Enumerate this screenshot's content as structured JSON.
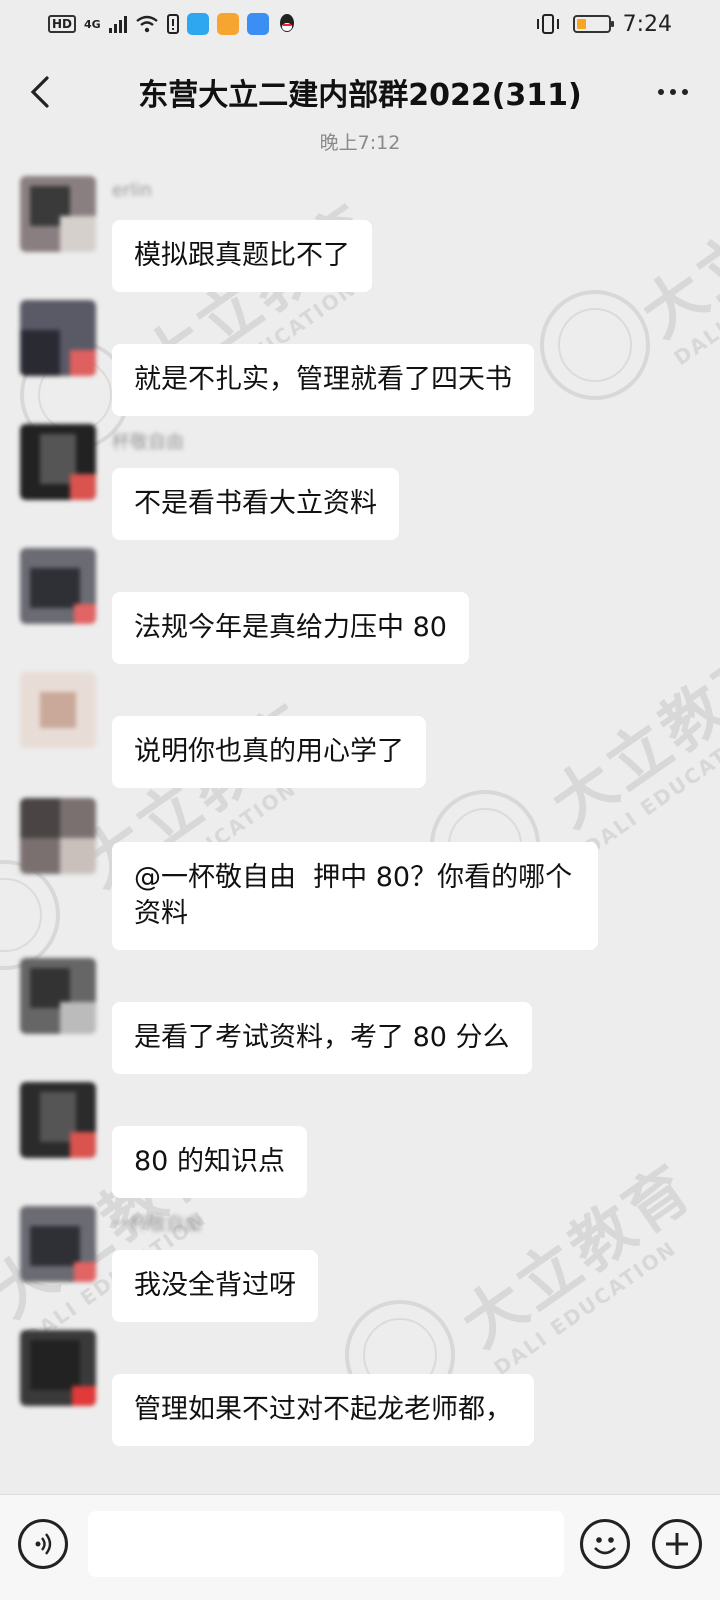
{
  "status_bar": {
    "hd_label": "HD",
    "network_label": "4G",
    "time": "7:24",
    "battery_color": "#f5a623",
    "icons": [
      "wifi-icon",
      "alert-icon",
      "app-blue-icon",
      "app-orange-icon",
      "app-search-icon",
      "qq-icon",
      "vibrate-icon"
    ]
  },
  "nav": {
    "title": "东营大立二建内部群2022(311)",
    "back_icon": "chevron-left-icon",
    "more_icon": "more-dots-icon"
  },
  "timestamp": "晚上7:12",
  "messages": [
    {
      "sender": "erlin",
      "text": "模拟跟真题比不了"
    },
    {
      "sender": "",
      "text": "就是不扎实，管理就看了四天书"
    },
    {
      "sender": "杯敬自由",
      "text": "不是看书看大立资料"
    },
    {
      "sender": "",
      "text": "法规今年是真给力压中 80"
    },
    {
      "sender": "",
      "text": "说明你也真的用心学了"
    },
    {
      "sender": "",
      "text": "@一杯敬自由  押中 80？你看的哪个资料"
    },
    {
      "sender": "",
      "text": "是看了考试资料，考了 80 分么"
    },
    {
      "sender": "",
      "text": "80 的知识点"
    },
    {
      "sender": "一杯敬自由",
      "text": "我没全背过呀"
    },
    {
      "sender": "",
      "text": "管理如果不过对不起龙老师都，"
    }
  ],
  "watermark": {
    "cn": "大立教育",
    "en": "DALI EDUCATION"
  },
  "input_bar": {
    "voice_icon": "voice-icon",
    "emoji_icon": "emoji-icon",
    "plus_icon": "plus-icon",
    "placeholder": ""
  }
}
